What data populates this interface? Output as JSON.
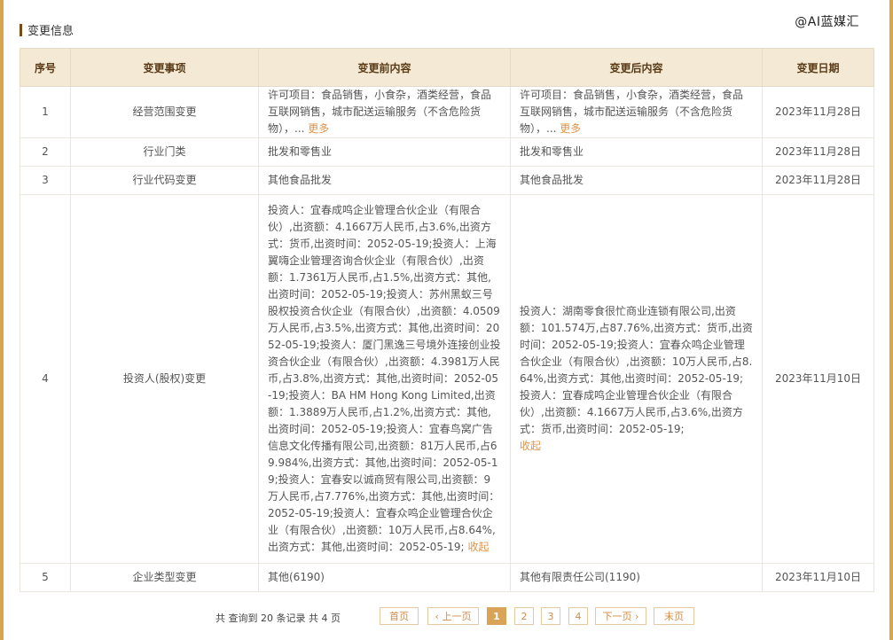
{
  "watermark": "@AI蓝媒汇",
  "section_title": "变更信息",
  "table": {
    "headers": [
      "序号",
      "变更事项",
      "变更前内容",
      "变更后内容",
      "变更日期"
    ],
    "rows": [
      {
        "index": "1",
        "item": "经营范围变更",
        "before": "许可项目：食品销售，小食杂，酒类经营，食品互联网销售，城市配送运输服务（不含危险货物），...",
        "before_link": "更多",
        "after": "许可项目：食品销售，小食杂，酒类经营，食品互联网销售，城市配送运输服务（不含危险货物），...",
        "after_link": "更多",
        "date": "2023年11月28日"
      },
      {
        "index": "2",
        "item": "行业门类",
        "before": "批发和零售业",
        "after": "批发和零售业",
        "date": "2023年11月28日"
      },
      {
        "index": "3",
        "item": "行业代码变更",
        "before": "其他食品批发",
        "after": "其他食品批发",
        "date": "2023年11月28日"
      },
      {
        "index": "4",
        "item": "投资人(股权)变更",
        "before": "投资人：宜春成鸣企业管理合伙企业（有限合伙）,出资额：4.1667万人民币,占3.6%,出资方式：货币,出资时间：2052-05-19;投资人：上海翼嗨企业管理咨询合伙企业（有限合伙）,出资额：1.7361万人民币,占1.5%,出资方式：其他,出资时间：2052-05-19;投资人：苏州黑蚁三号股权投资合伙企业（有限合伙）,出资额：4.0509万人民币,占3.5%,出资方式：其他,出资时间：2052-05-19;投资人：厦门黑逸三号境外连接创业投资合伙企业（有限合伙）,出资额：4.3981万人民币,占3.8%,出资方式：其他,出资时间：2052-05-19;投资人：BA HM Hong Kong Limited,出资额：1.3889万人民币,占1.2%,出资方式：其他,出资时间：2052-05-19;投资人：宜春鸟窝广告信息文化传播有限公司,出资额：81万人民币,占69.984%,出资方式：其他,出资时间：2052-05-19;投资人：宜春安以诚商贸有限公司,出资额：9万人民币,占7.776%,出资方式：其他,出资时间：2052-05-19;投资人：宜春众鸣企业管理合伙企业（有限合伙）,出资额：10万人民币,占8.64%,出资方式：其他,出资时间：2052-05-19;",
        "before_link": "收起",
        "after": "投资人：湖南零食很忙商业连锁有限公司,出资额：101.574万,占87.76%,出资方式：货币,出资时间：2052-05-19;投资人：宜春众鸣企业管理合伙企业（有限合伙）,出资额：10万人民币,占8.64%,出资方式：其他,出资时间：2052-05-19;投资人：宜春成鸣企业管理合伙企业（有限合伙）,出资额：4.1667万人民币,占3.6%,出资方式：货币,出资时间：2052-05-19;",
        "after_link": "收起",
        "date": "2023年11月10日"
      },
      {
        "index": "5",
        "item": "企业类型变更",
        "before": "其他(6190)",
        "after": "其他有限责任公司(1190)",
        "date": "2023年11月10日"
      }
    ]
  },
  "pagination": {
    "info": "共 查询到 20 条记录 共 4 页",
    "first": "首页",
    "prev": "‹ 上一页",
    "pages": [
      "1",
      "2",
      "3",
      "4"
    ],
    "active_page": "1",
    "next": "下一页 ›",
    "last": "末页"
  }
}
